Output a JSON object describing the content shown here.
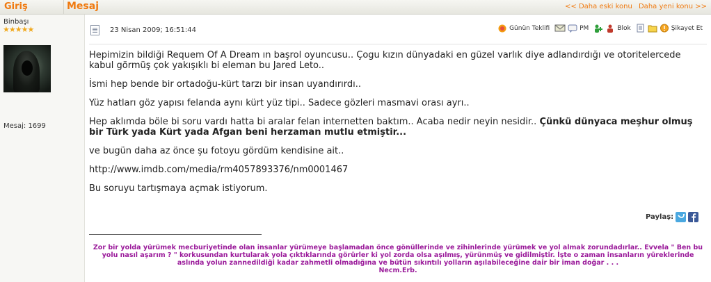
{
  "header": {
    "left_label": "Giriş",
    "mid_label": "Mesaj",
    "older_link": "<< Daha eski konu",
    "newer_link": "Daha yeni konu >>"
  },
  "user": {
    "rank": "Binbaşı",
    "stars": "★★★★★",
    "posts": "Mesaj: 1699"
  },
  "post": {
    "date": "23 Nisan 2009; 16:51:44",
    "tools": {
      "offer": "Günün Teklifi",
      "pm": "PM",
      "block": "Blok",
      "report": "Şikayet Et"
    },
    "paragraphs": [
      "Hepimizin bildiği Requem Of A Dream ın başrol oyuncusu.. Çogu kızın dünyadaki en güzel varlık diye adlandırdığı ve otoritelercede kabul görmüş çok yakışıklı bi eleman bu Jared Leto..",
      "İsmi hep bende bir ortadoğu-kürt tarzı bir insan uyandırırdı..",
      "Yüz hatları göz yapısı felanda aynı kürt yüz tipi.. Sadece gözleri masmavi orası ayrı.."
    ],
    "para4_normal": "Hep aklımda böle bi soru vardı hatta bi aralar felan internetten baktım.. Acaba nedir neyin nesidir.. ",
    "para4_bold": "Çünkü dünyaca meşhur olmuş bir Türk yada Kürt yada Afgan beni herzaman mutlu etmiştir...",
    "para5": "ve bugün daha az önce şu fotoyu gördüm kendisine ait..",
    "link": "http://www.imdb.com/media/rm4057893376/nm0001467",
    "para7": "Bu soruyu tartışmaya açmak istiyorum."
  },
  "share": {
    "label": "Paylaş:"
  },
  "signature": {
    "text": "Zor bir yolda yürümek mecburiyetinde olan insanlar yürümeye başlamadan önce gönüllerinde ve zihinlerinde yürümek ve yol almak zorundadırlar.. Evvela \" Ben bu yolu nasıl aşarım ? \" korkusundan kurtularak yola çıktıklarında görürler ki yol zorda olsa aşılmış, yürünmüş ve gidilmiştir. İşte o zaman insanların yüreklerinde aslında yolun zannedildiği kadar zahmetli olmadığına ve bütün sıkıntılı yolların aşılabileceğine dair bir iman doğar . . .",
    "author": "Necm.Erb."
  },
  "colors": {
    "accent": "#f07a10",
    "signature": "#9a1a9a"
  },
  "icons": [
    "document-icon",
    "offer-icon",
    "email-icon",
    "pm-icon",
    "buddy-icon",
    "block-icon",
    "copy-icon",
    "folder-icon",
    "warning-icon",
    "twitter-icon",
    "facebook-icon"
  ]
}
